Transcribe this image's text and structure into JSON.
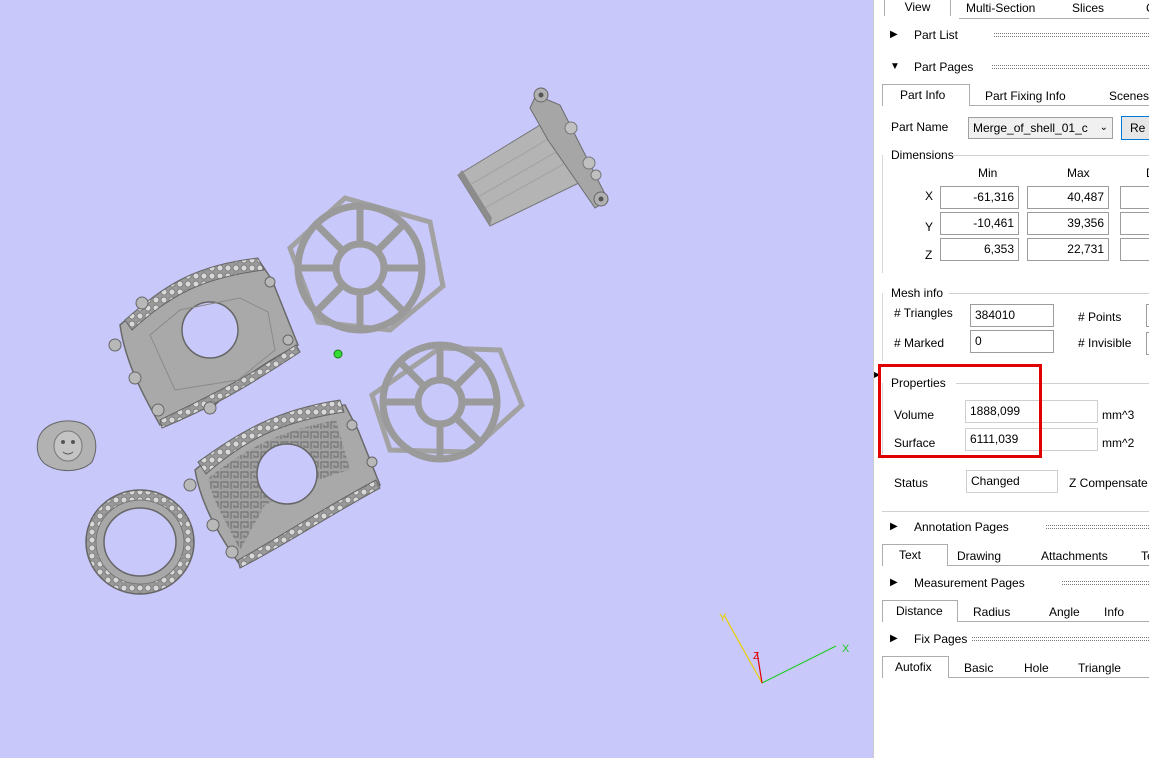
{
  "top_tabs": {
    "view": "View",
    "multi_section": "Multi-Section",
    "slices": "Slices",
    "more": "C"
  },
  "part_list": {
    "label": "Part List"
  },
  "part_pages": {
    "label": "Part Pages",
    "tabs": {
      "part_info": "Part Info",
      "part_fixing": "Part Fixing Info",
      "scenes": "Scenes"
    },
    "part_name_label": "Part Name",
    "part_name_value": "Merge_of_shell_01_c",
    "rename_button": "Re"
  },
  "dimensions": {
    "label": "Dimensions",
    "col_min": "Min",
    "col_max": "Max",
    "col_delta": "D",
    "rows": [
      {
        "axis": "X",
        "min": "-61,316",
        "max": "40,487"
      },
      {
        "axis": "Y",
        "min": "-10,461",
        "max": "39,356"
      },
      {
        "axis": "Z",
        "min": "6,353",
        "max": "22,731"
      }
    ]
  },
  "mesh_info": {
    "label": "Mesh info",
    "triangles_label": "# Triangles",
    "triangles_value": "384010",
    "points_label": "# Points",
    "marked_label": "# Marked",
    "marked_value": "0",
    "invisible_label": "# Invisible"
  },
  "properties": {
    "label": "Properties",
    "volume_label": "Volume",
    "volume_value": "1888,099",
    "volume_unit": "mm^3",
    "surface_label": "Surface",
    "surface_value": "6111,039",
    "surface_unit": "mm^2"
  },
  "status": {
    "label": "Status",
    "value": "Changed",
    "z_comp_label": "Z Compensate"
  },
  "annotation_pages": {
    "label": "Annotation Pages",
    "tabs": {
      "text": "Text",
      "drawing": "Drawing",
      "attachments": "Attachments",
      "more": "Te"
    }
  },
  "measurement_pages": {
    "label": "Measurement Pages",
    "tabs": {
      "distance": "Distance",
      "radius": "Radius",
      "angle": "Angle",
      "info": "Info"
    }
  },
  "fix_pages": {
    "label": "Fix Pages",
    "tabs": {
      "autofix": "Autofix",
      "basic": "Basic",
      "hole": "Hole",
      "triangle": "Triangle"
    }
  },
  "axes": {
    "x": "X",
    "y": "Y",
    "z": "Z"
  },
  "colors": {
    "viewport_bg": "#c8c8fb",
    "part_gray": "#a8a8a8",
    "highlight": "#e00000",
    "axis_x": "#22cc22",
    "axis_y": "#e8d000",
    "axis_z": "#e00000"
  }
}
